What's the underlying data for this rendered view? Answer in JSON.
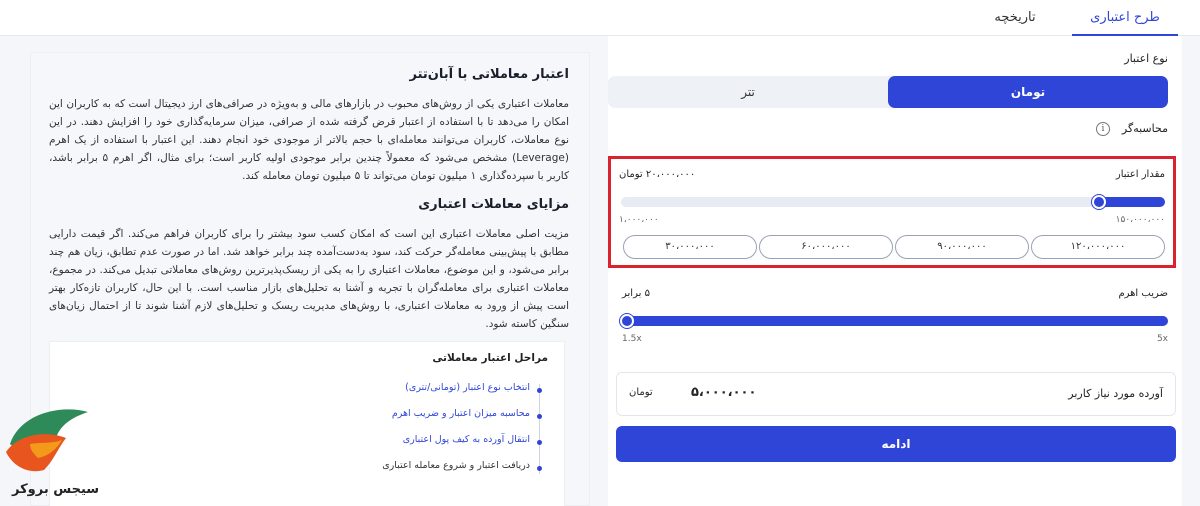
{
  "tabs": {
    "active": "طرح اعتباری",
    "inactive": "تاریخچه"
  },
  "form": {
    "credit_type_label": "نوع اعتبار",
    "currency_options": [
      "تومان",
      "تتر"
    ],
    "selected_currency": "تومان",
    "calculator_label": "محاسبه‌گر",
    "info_icon": "i",
    "credit_amount": {
      "label": "مقدار اعتبار",
      "value_text": "۲۰،۰۰۰،۰۰۰ تومان",
      "min_label": "۱،۰۰۰،۰۰۰",
      "max_label": "۱۵۰،۰۰۰،۰۰۰",
      "min": 1000000,
      "max": 150000000,
      "value": 20000000,
      "presets": [
        "۱۲۰،۰۰۰،۰۰۰",
        "۹۰،۰۰۰،۰۰۰",
        "۶۰،۰۰۰،۰۰۰",
        "۳۰،۰۰۰،۰۰۰"
      ]
    },
    "leverage": {
      "label": "ضریب اهرم",
      "value_text": "۵ برابر",
      "min_label": "1.5x",
      "max_label": "5x",
      "min": 1.5,
      "max": 5,
      "value": 5
    },
    "required_margin_label": "آورده مورد نیاز کاربر",
    "required_margin_value": "۵،۰۰۰،۰۰۰",
    "required_margin_unit": "تومان",
    "continue_label": "ادامه"
  },
  "info": {
    "title": "اعتبار معاملاتی با آبان‌تتر",
    "paragraph1": "معاملات اعتباری یکی از روش‌های محبوب در بازارهای مالی و به‌ویژه در صرافی‌های ارز دیجیتال است که به کاربران این امکان را می‌دهد تا با استفاده از اعتبار قرض گرفته شده از صرافی، میزان سرمایه‌گذاری خود را افزایش دهند. در این نوع معاملات، کاربران می‌توانند معامله‌ای با حجم بالاتر از موجودی خود انجام دهند. این اعتبار با استفاده از یک اهرم (Leverage) مشخص می‌شود که معمولاً چندین برابر موجودی اولیه کاربر است؛ برای مثال، اگر اهرم ۵ برابر باشد، کاربر با سپرده‌گذاری ۱ میلیون تومان می‌تواند تا ۵ میلیون تومان معامله کند.",
    "subtitle": "مزایای معاملات اعتباری",
    "paragraph2": "مزیت اصلی معاملات اعتباری این است که امکان کسب سود بیشتر را برای کاربران فراهم می‌کند. اگر قیمت دارایی مطابق با پیش‌بینی معامله‌گر حرکت کند، سود به‌دست‌آمده چند برابر خواهد شد. اما در صورت عدم تطابق، زیان هم چند برابر می‌شود، و این موضوع، معاملات اعتباری را به یکی از ریسک‌پذیرترین روش‌های معاملاتی تبدیل می‌کند. در مجموع، معاملات اعتباری برای معامله‌گران با تجربه و آشنا به تحلیل‌های بازار مناسب است. با این حال، کاربران تازه‌کار بهتر است پیش از ورود به معاملات اعتباری، با روش‌های مدیریت ریسک و تحلیل‌های لازم آشنا شوند تا از احتمال زیان‌های سنگین کاسته شود.",
    "steps_title": "مراحل اعتبار معاملاتی",
    "steps": [
      "انتخاب نوع اعتبار (تومانی/تتری)",
      "محاسبه میزان اعتبار و ضریب اهرم",
      "انتقال آورده به کیف پول اعتباری",
      "دریافت اعتبار و شروع معامله اعتباری"
    ]
  },
  "logo": {
    "text": "سیجس بروکر"
  },
  "colors": {
    "accent": "#2f45d8",
    "highlight": "#d9242f"
  }
}
